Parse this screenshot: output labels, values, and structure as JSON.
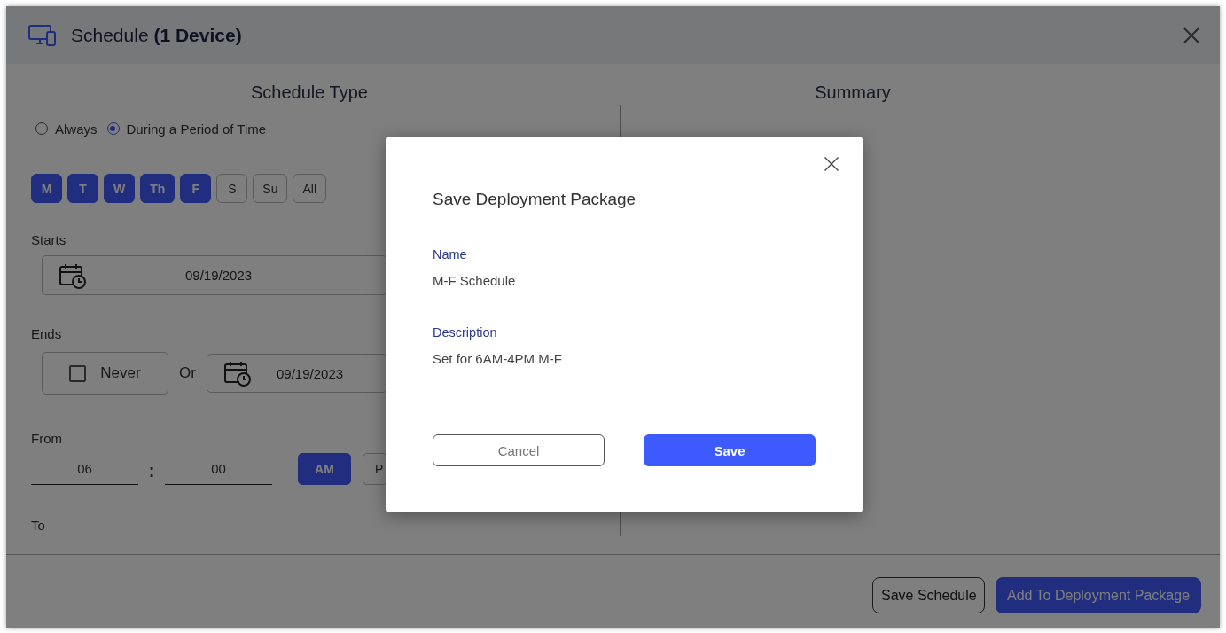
{
  "window": {
    "title": "Schedule **(1 Device)**"
  },
  "schedule_type": {
    "heading": "Schedule Type",
    "options": [
      {
        "label": "Always",
        "selected": false
      },
      {
        "label": "During a Period of Time",
        "selected": true
      }
    ],
    "days": [
      {
        "label": "M",
        "selected": true
      },
      {
        "label": "T",
        "selected": true
      },
      {
        "label": "W",
        "selected": true
      },
      {
        "label": "Th",
        "selected": true
      },
      {
        "label": "F",
        "selected": true
      },
      {
        "label": "S",
        "selected": false
      },
      {
        "label": "Su",
        "selected": false
      },
      {
        "label": "All",
        "selected": false
      }
    ],
    "starts": {
      "label": "Starts",
      "value": "09/19/2023"
    },
    "ends": {
      "label": "Ends",
      "never": {
        "label": "Never",
        "checked": false
      },
      "or_label": "Or",
      "value": "09/19/2023"
    },
    "from": {
      "label": "From",
      "hour": "06",
      "separator": ":",
      "minute": "00",
      "periods": [
        {
          "label": "AM",
          "selected": true
        },
        {
          "label": "P",
          "selected": false
        }
      ]
    },
    "to": {
      "label": "To"
    }
  },
  "summary": {
    "heading": "Summary"
  },
  "footer": {
    "buttons": [
      {
        "label": "Save Schedule",
        "kind": "secondary"
      },
      {
        "label": "Add To Deployment Package",
        "kind": "primary"
      }
    ]
  },
  "dialog": {
    "title": "Save Deployment Package",
    "fields": [
      {
        "label": "Name",
        "value": "M-F Schedule"
      },
      {
        "label": "Description",
        "value": "Set for 6AM-4PM M-F"
      }
    ],
    "buttons": [
      {
        "label": "Cancel",
        "kind": "secondary"
      },
      {
        "label": "Save",
        "kind": "primary"
      }
    ]
  }
}
